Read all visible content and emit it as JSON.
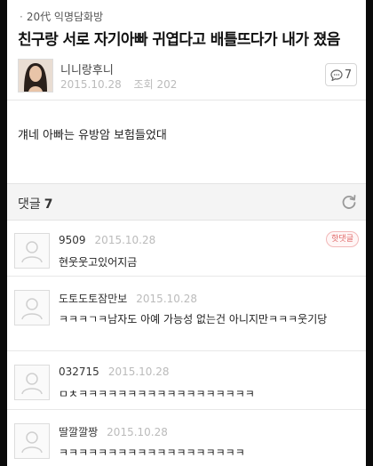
{
  "post": {
    "board_name": "20代 익명담화방",
    "title": "친구랑 서로 자기아빠 귀엽다고 배틀뜨다가 내가 졌음",
    "author": "니니랑후니",
    "date": "2015.10.28",
    "views": "조회 202",
    "comment_count": "7",
    "body": "걔네 아빠는 유방암 보험들었대"
  },
  "comments_header": {
    "label": "댓글",
    "count": "7"
  },
  "comments": [
    {
      "name": "9509",
      "date": "2015.10.28",
      "text": "현웃웃고있어지금",
      "badge": "핫댓글"
    },
    {
      "name": "도토도토잠만보",
      "date": "2015.10.28",
      "text": "ㅋㅋㅋㄱㅋ남자도 아예 가능성 없는건 아니지만ㅋㅋㅋ웃기당"
    },
    {
      "name": "032715",
      "date": "2015.10.28",
      "text": "ㅁㅊㅋㅋㅋㅋㅋㅋㅋㅋㅋㅋㅋㅋㅋㅋㅋㅋㅋㅋ"
    },
    {
      "name": "딸깔깔짱",
      "date": "2015.10.28",
      "text": "ㅋㅋㅋㅋㅋㅋㅋㅋㅋㅋㅋㅋㅋㅋㅋㅋㅋㅋㅋ"
    }
  ],
  "colors": {
    "badge": "#e06b6b",
    "meta_gray": "#bbbbbb"
  }
}
